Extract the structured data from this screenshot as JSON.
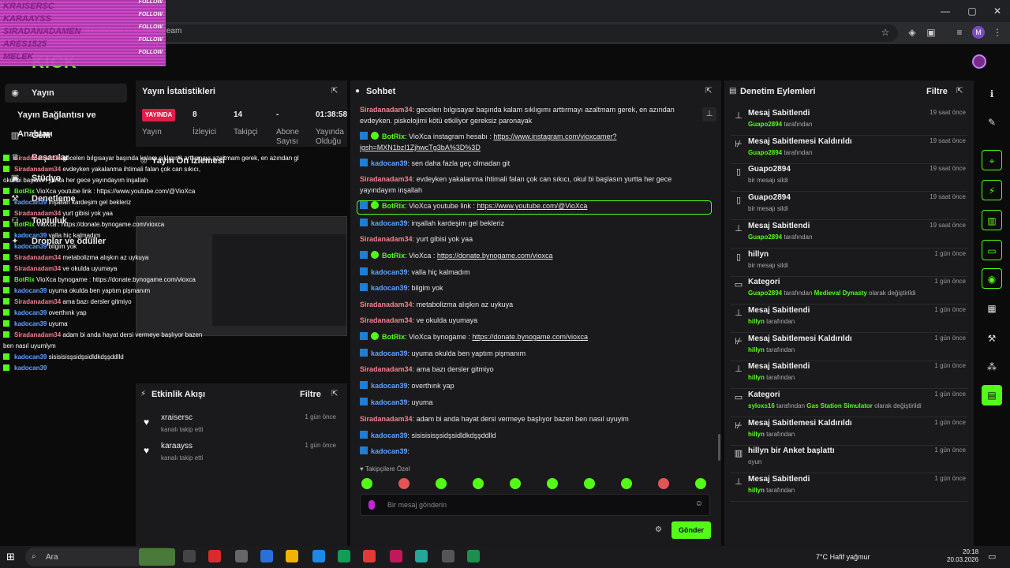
{
  "browser": {
    "url": "dashboard.kick.com/stream",
    "profile_initial": "M"
  },
  "follow_overlay": {
    "names": [
      "KRAISERSC",
      "KARAAYSS",
      "SIRADANADAMEN",
      "ARES1525",
      "MELEK"
    ],
    "tag": "FOLLOW"
  },
  "nav": {
    "items": [
      {
        "label": "Yayın",
        "icon": "broadcast-icon"
      },
      {
        "label": "Yayın Bağlantısı ve Anahtarı",
        "icon": "key-icon"
      },
      {
        "label": "Gelir",
        "icon": "chart-icon"
      },
      {
        "label": "Başarılar",
        "icon": "trophy-icon"
      },
      {
        "label": "Stüdyo",
        "icon": "studio-icon"
      },
      {
        "label": "Denetleme",
        "icon": "wrench-icon"
      },
      {
        "label": "Topluluk",
        "icon": "people-icon"
      },
      {
        "label": "Droplar ve ödüller",
        "icon": "gift-icon"
      }
    ]
  },
  "chat_overlay": [
    {
      "user": "Siradanadam34",
      "text": "gecelerı bılgısayar başında kalam sıklıgımı arttırmayı azaltmam gerek, en azından gl"
    },
    {
      "user": "Siradanadam34",
      "text": "evdeyken yakalanma ihtimali falan çok can sıkıcı,"
    },
    {
      "user": "",
      "text": "okul bi başlasın yurtta her gece yayındayım inşallah"
    },
    {
      "user": "BotRix",
      "text": "VioXca youtube link : https://www.youtube.com/@VioXca"
    },
    {
      "user": "kadocan39",
      "text": "inşallah kardeşim gel bekleriz"
    },
    {
      "user": "Siradanadam34",
      "text": "yurt gibisi yok yaa"
    },
    {
      "user": "BotRix",
      "text": "VioXca : https://donate.bynogame.com/vioxca"
    },
    {
      "user": "kadocan39",
      "text": "valla hiç kalmadım"
    },
    {
      "user": "kadocan39",
      "text": "bilgim yok"
    },
    {
      "user": "Siradanadam34",
      "text": "metabolizma alışkın az uykuya"
    },
    {
      "user": "Siradanadam34",
      "text": "ve okulda uyumaya"
    },
    {
      "user": "BotRix",
      "text": "VioXca bynogame : https://donate.bynogame.com/vioxca"
    },
    {
      "user": "kadocan39",
      "text": "uyuma okulda ben yaptım pişmanım"
    },
    {
      "user": "Siradanadam34",
      "text": "ama bazı dersler gitmiyo"
    },
    {
      "user": "kadocan39",
      "text": "overthınk yap"
    },
    {
      "user": "kadocan39",
      "text": "uyuma"
    },
    {
      "user": "Siradanadam34",
      "text": "adam bi anda hayat dersi vermeye başlıyor bazen"
    },
    {
      "user": "",
      "text": "ben nasıl uyumlym"
    },
    {
      "user": "kadocan39",
      "text": "sisisisisşsidşsidldkdşşddlld"
    },
    {
      "user": "kadocan39",
      "text": ""
    }
  ],
  "stats": {
    "title": "Yayın İstatistikleri",
    "live": "YAYINDA",
    "viewers": "8",
    "followers": "14",
    "subs": "-",
    "uptime": "01:38:58",
    "labels": [
      "Yayın",
      "İzleyici",
      "Takipçi",
      "Abone Sayısı",
      "Yayında Olduğu"
    ]
  },
  "preview": {
    "title": "Yayın Ön İzlemesi"
  },
  "activity": {
    "title": "Etkinlik Akışı",
    "filter": "Filtre",
    "items": [
      {
        "name": "xraisersc",
        "sub": "kanalı takip etti",
        "time": "1 gün önce"
      },
      {
        "name": "karaayss",
        "sub": "kanalı takip etti",
        "time": "1 gün önce"
      }
    ]
  },
  "chat": {
    "title": "Sohbet",
    "followers_only": "Takipçilere Özel",
    "placeholder": "Bir mesaj gönderin",
    "send": "Gönder",
    "messages": [
      {
        "user": "Siradanadam34",
        "color": "red",
        "badges": 0,
        "text": "gecelerı bılgısayar başında kalam sıklıgımı arttırmayı azaltmam gerek, en azından evdeyken. piskolojimi kötü etkiliyor gereksiz paronayak",
        "link": ""
      },
      {
        "user": "BotRix",
        "color": "green",
        "badges": 2,
        "text": "VioXca instagram hesabı : ",
        "link": "https://www.instagram.com/vioxcamer?igsh=MXN1bzI1ZjhwcTg3bA%3D%3D"
      },
      {
        "user": "kadocan39",
        "color": "blue",
        "badges": 1,
        "text": "sen daha fazla geç olmadan git",
        "link": ""
      },
      {
        "user": "Siradanadam34",
        "color": "red",
        "badges": 0,
        "text": "evdeyken yakalanma ihtimali falan çok can sıkıcı, okul bi başlasın yurtta her gece yayındayım inşallah",
        "link": ""
      },
      {
        "user": "BotRix",
        "color": "green",
        "badges": 2,
        "text": "VioXca youtube link : ",
        "link": "https://www.youtube.com/@VioXca"
      },
      {
        "user": "kadocan39",
        "color": "blue",
        "badges": 1,
        "text": "inşallah kardeşim gel bekleriz",
        "link": ""
      },
      {
        "user": "Siradanadam34",
        "color": "red",
        "badges": 0,
        "text": "yurt gibisi yok yaa",
        "link": ""
      },
      {
        "user": "BotRix",
        "color": "green",
        "badges": 2,
        "text": "VioXca : ",
        "link": "https://donate.bynogame.com/vioxca"
      },
      {
        "user": "kadocan39",
        "color": "blue",
        "badges": 1,
        "text": "valla hiç kalmadım",
        "link": ""
      },
      {
        "user": "kadocan39",
        "color": "blue",
        "badges": 1,
        "text": "bilgim yok",
        "link": ""
      },
      {
        "user": "Siradanadam34",
        "color": "red",
        "badges": 0,
        "text": "metabolizma alışkın az uykuya",
        "link": ""
      },
      {
        "user": "Siradanadam34",
        "color": "red",
        "badges": 0,
        "text": "ve okulda uyumaya",
        "link": ""
      },
      {
        "user": "BotRix",
        "color": "green",
        "badges": 2,
        "text": "VioXca bynogame : ",
        "link": "https://donate.bynogame.com/vioxca"
      },
      {
        "user": "kadocan39",
        "color": "blue",
        "badges": 1,
        "text": "uyuma okulda ben yaptım pişmanım",
        "link": ""
      },
      {
        "user": "Siradanadam34",
        "color": "red",
        "badges": 0,
        "text": "ama bazı dersler gitmiyo",
        "link": ""
      },
      {
        "user": "kadocan39",
        "color": "blue",
        "badges": 1,
        "text": "overthınk yap",
        "link": ""
      },
      {
        "user": "kadocan39",
        "color": "blue",
        "badges": 1,
        "text": "uyuma",
        "link": ""
      },
      {
        "user": "Siradanadam34",
        "color": "red",
        "badges": 0,
        "text": "adam bi anda hayat dersi vermeye başlıyor bazen ben nasıl uyuyim",
        "link": ""
      },
      {
        "user": "kadocan39",
        "color": "blue",
        "badges": 1,
        "text": "sisisisisşsidşsidldkdşşddlld",
        "link": ""
      },
      {
        "user": "kadocan39",
        "color": "blue",
        "badges": 1,
        "text": "",
        "link": ""
      }
    ]
  },
  "mod": {
    "title": "Denetim Eylemleri",
    "filter": "Filtre",
    "items": [
      {
        "icon": "pin-icon",
        "title": "Mesaj Sabitlendi",
        "actor": "Guapo2894",
        "rest": " tarafından",
        "time": "19 saat önce"
      },
      {
        "icon": "unpin-icon",
        "title": "Mesaj Sabitlemesi Kaldırıldı",
        "actor": "Guapo2894",
        "rest": " tarafından",
        "time": "19 saat önce"
      },
      {
        "icon": "trash-icon",
        "title": "Guapo2894",
        "actor": "",
        "rest": "bir mesajı sildi",
        "time": "19 saat önce"
      },
      {
        "icon": "trash-icon",
        "title": "Guapo2894",
        "actor": "",
        "rest": "bir mesajı sildi",
        "time": "19 saat önce"
      },
      {
        "icon": "pin-icon",
        "title": "Mesaj Sabitlendi",
        "actor": "Guapo2894",
        "rest": " tarafından",
        "time": "19 saat önce"
      },
      {
        "icon": "trash-icon",
        "title": "hillyn",
        "actor": "",
        "rest": "bir mesajı sildi",
        "time": "1 gün önce"
      },
      {
        "icon": "category-icon",
        "title": "Kategori",
        "actor": "Guapo2894",
        "rest": " tarafından ",
        "extra": "Medieval Dynasty",
        "extra2": " olarak değiştirildi",
        "time": "1 gün önce"
      },
      {
        "icon": "pin-icon",
        "title": "Mesaj Sabitlendi",
        "actor": "hillyn",
        "rest": " tarafından",
        "time": "1 gün önce"
      },
      {
        "icon": "unpin-icon",
        "title": "Mesaj Sabitlemesi Kaldırıldı",
        "actor": "hillyn",
        "rest": " tarafından",
        "time": "1 gün önce"
      },
      {
        "icon": "pin-icon",
        "title": "Mesaj Sabitlendi",
        "actor": "hillyn",
        "rest": " tarafından",
        "time": "1 gün önce"
      },
      {
        "icon": "category-icon",
        "title": "Kategori",
        "actor": "syloxs16",
        "rest": " tarafından ",
        "extra": "Gas Station Simulator",
        "extra2": " olarak değiştirildi",
        "time": "1 gün önce"
      },
      {
        "icon": "unpin-icon",
        "title": "Mesaj Sabitlemesi Kaldırıldı",
        "actor": "hillyn",
        "rest": " tarafından",
        "time": "1 gün önce"
      },
      {
        "icon": "poll-icon",
        "title": "hillyn bir Anket başlattı",
        "actor": "",
        "rest": "oyun",
        "time": "1 gün önce"
      },
      {
        "icon": "pin-icon",
        "title": "Mesaj Sabitlendi",
        "actor": "hillyn",
        "rest": " tarafından",
        "time": "1 gün önce"
      }
    ]
  },
  "taskbar": {
    "search": "Ara",
    "weather": "7°C  Hafif yağmur",
    "time": "20:18",
    "date": "20.03.2026"
  },
  "colors": {
    "brand": "#53fc18",
    "live": "#e11d48",
    "bg": "#0b0b0c",
    "panel": "#1a1a1c"
  }
}
